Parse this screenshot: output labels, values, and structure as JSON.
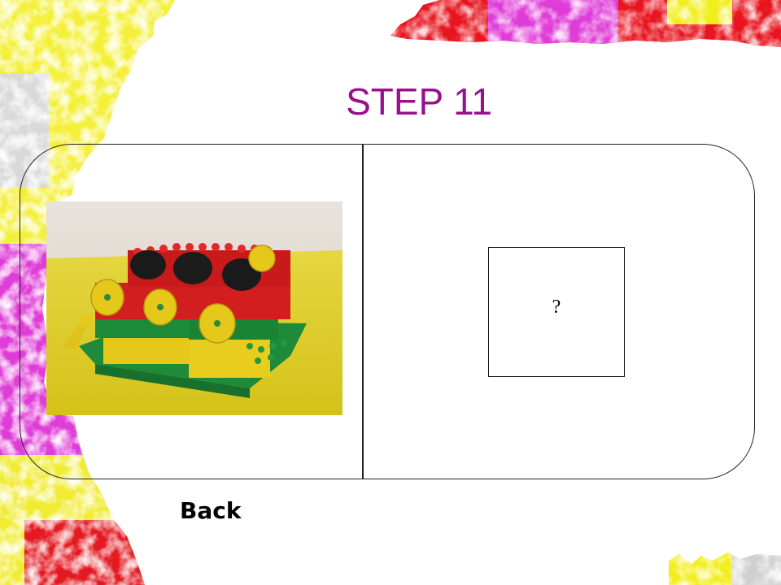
{
  "slide": {
    "title": "STEP 11",
    "title_color": "#99108f"
  },
  "left_panel": {
    "image_subject": "lego-duplo-model"
  },
  "right_panel": {
    "question_text": "?"
  },
  "navigation": {
    "back_label": "Back"
  },
  "colors": {
    "border_yellow": "#f2ee1c",
    "border_magenta": "#e23ad6",
    "border_red": "#e8141e",
    "background": "#ffffff"
  }
}
